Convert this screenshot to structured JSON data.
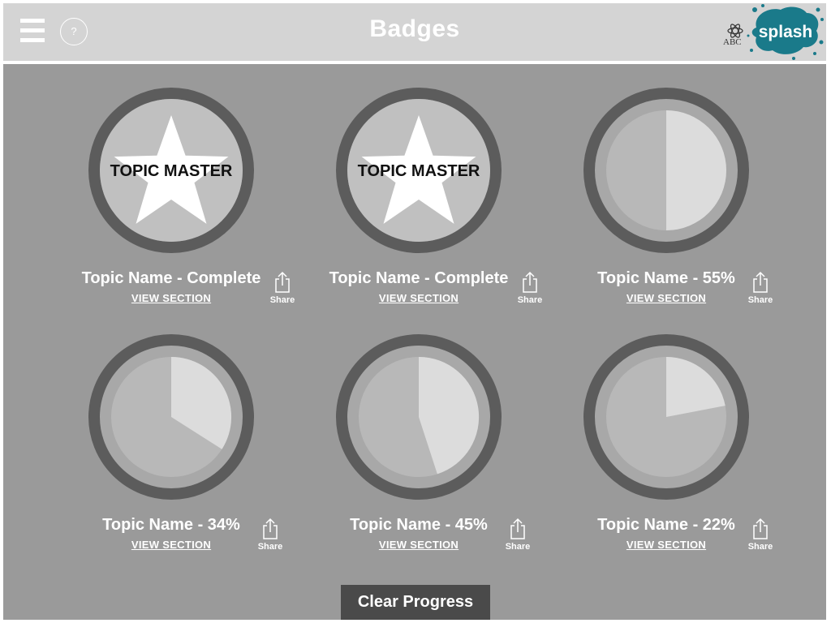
{
  "header": {
    "title": "Badges",
    "menu_icon": "menu-icon",
    "help_label": "?",
    "abc_label": "ABC",
    "splash_label": "splash",
    "colors": {
      "header_bg": "#d4d4d4",
      "splash_blue": "#1a7a8a"
    }
  },
  "badges": [
    {
      "caption": "Topic Name - Complete",
      "link": "VIEW SECTION",
      "share": "Share",
      "type": "master",
      "master_label": "TOPIC MASTER",
      "progress": 1.0
    },
    {
      "caption": "Topic Name - Complete",
      "link": "VIEW SECTION",
      "share": "Share",
      "type": "master",
      "master_label": "TOPIC MASTER",
      "progress": 1.0
    },
    {
      "caption": "Topic Name - 55%",
      "link": "VIEW SECTION",
      "share": "Share",
      "type": "pie",
      "progress": 0.5
    },
    {
      "caption": "Topic Name - 34%",
      "link": "VIEW SECTION",
      "share": "Share",
      "type": "pie",
      "progress": 0.34
    },
    {
      "caption": "Topic Name - 45%",
      "link": "VIEW SECTION",
      "share": "Share",
      "type": "pie",
      "progress": 0.45
    },
    {
      "caption": "Topic Name - 22%",
      "link": "VIEW SECTION",
      "share": "Share",
      "type": "pie",
      "progress": 0.22
    }
  ],
  "footer": {
    "clear_label": "Clear Progress"
  },
  "colors": {
    "background": "#9a9a9a",
    "ring": "#5c5c5c",
    "inner_ring": "#a8a8a8",
    "pie_bg": "#b8b8b8",
    "pie_fill": "#dcdcdc",
    "master_bg": "#c0c0c0"
  }
}
